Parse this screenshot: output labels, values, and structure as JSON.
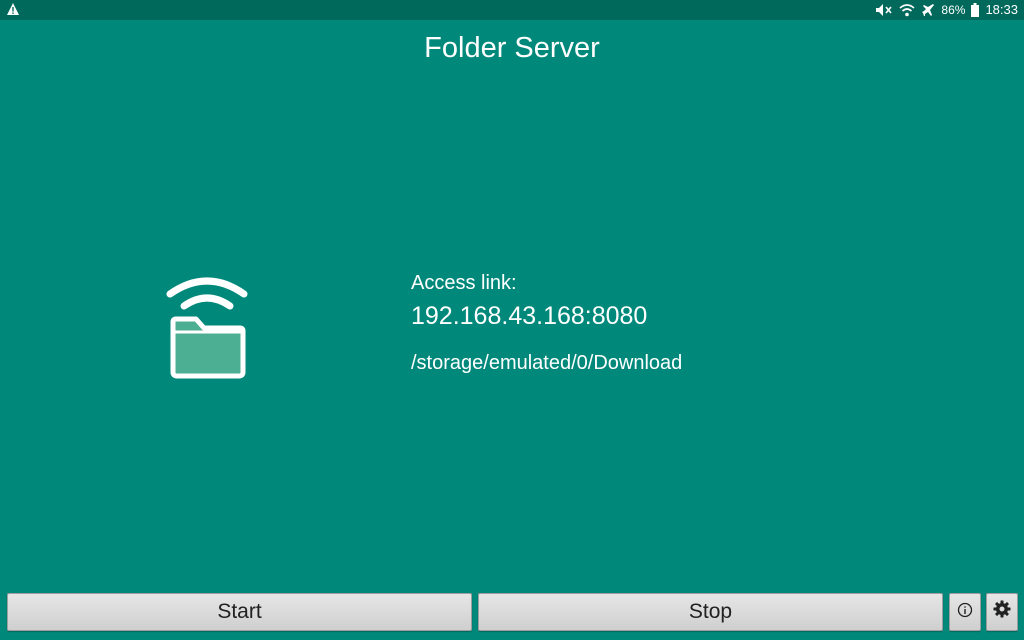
{
  "status_bar": {
    "warning_icon": "warning-triangle-icon",
    "battery_percent": "86%",
    "time": "18:33",
    "icons": [
      "mute-icon",
      "wifi-icon",
      "airplane-icon",
      "battery-icon"
    ]
  },
  "app": {
    "title": "Folder Server",
    "main_icon": "folder-wifi-icon"
  },
  "info": {
    "access_label": "Access link:",
    "access_link": "192.168.43.168:8080",
    "folder_path": "/storage/emulated/0/Download"
  },
  "buttons": {
    "start_label": "Start",
    "stop_label": "Stop",
    "info_icon": "info-icon",
    "settings_icon": "gear-icon"
  },
  "colors": {
    "background": "#00897b",
    "status_bar": "#00695c",
    "folder_fill": "#4caf93",
    "button": "#dcdcdc"
  }
}
